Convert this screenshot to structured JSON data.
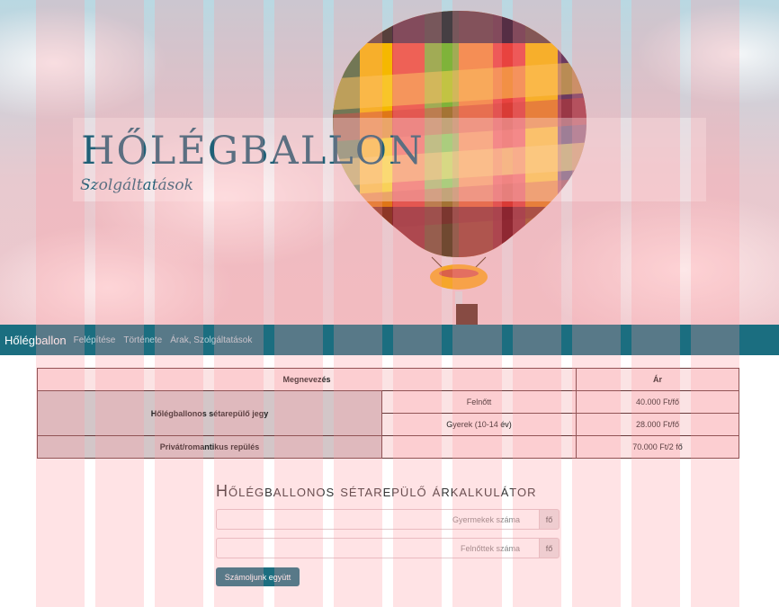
{
  "hero": {
    "title": "HŐLÉGBALLON",
    "subtitle": "Szolgáltatások"
  },
  "navbar": {
    "brand": "Hőlégballon",
    "links": [
      "Felépítése",
      "Története",
      "Árak, Szolgáltatások"
    ]
  },
  "table": {
    "headers": [
      "Megnevezés",
      "Ár"
    ],
    "rows": [
      {
        "name": "Hőlégballonos sétarepülő jegy",
        "type": "Felnőtt",
        "price": "40.000 Ft/fő"
      },
      {
        "name": "",
        "type": "Gyerek (10-14 év)",
        "price": "28.000 Ft/fő"
      },
      {
        "name": "Privát/romantikus repülés",
        "type": "",
        "price": "70.000 Ft/2 fő"
      }
    ]
  },
  "calculator": {
    "title": "Hőlégballonos sétarepülő árkalkulátor",
    "children_placeholder": "Gyermekek száma",
    "adults_placeholder": "Felnőttek száma",
    "unit": "fő",
    "button_label": "Számoljunk együtt"
  },
  "colors": {
    "accent": "#1b6e80",
    "title": "#1f6077",
    "grid_overlay": "#ff96a0"
  },
  "icons": [
    "hot-air-balloon-image"
  ]
}
